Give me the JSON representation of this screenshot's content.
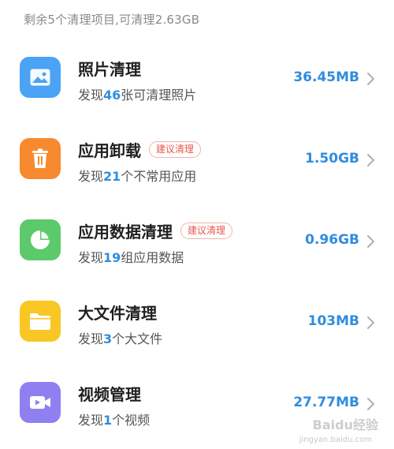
{
  "summary": "剩余5个清理项目,可清理2.63GB",
  "items": [
    {
      "title": "照片清理",
      "badge": "",
      "desc_prefix": "发现",
      "desc_num": "46",
      "desc_suffix": "张可清理照片",
      "size": "36.45MB",
      "icon": "image-icon",
      "color": "#4aa3f5"
    },
    {
      "title": "应用卸载",
      "badge": "建议清理",
      "desc_prefix": "发现",
      "desc_num": "21",
      "desc_suffix": "个不常用应用",
      "size": "1.50GB",
      "icon": "trash-icon",
      "color": "#f78a2e"
    },
    {
      "title": "应用数据清理",
      "badge": "建议清理",
      "desc_prefix": "发现",
      "desc_num": "19",
      "desc_suffix": "组应用数据",
      "size": "0.96GB",
      "icon": "pie-chart-icon",
      "color": "#5cc96b"
    },
    {
      "title": "大文件清理",
      "badge": "",
      "desc_prefix": "发现",
      "desc_num": "3",
      "desc_suffix": "个大文件",
      "size": "103MB",
      "icon": "folder-icon",
      "color": "#f9c623"
    },
    {
      "title": "视频管理",
      "badge": "",
      "desc_prefix": "发现",
      "desc_num": "1",
      "desc_suffix": "个视频",
      "size": "27.77MB",
      "icon": "video-icon",
      "color": "#8f80f2"
    }
  ],
  "watermark": "Baidu经验",
  "watermark_url": "jingyan.baidu.com"
}
